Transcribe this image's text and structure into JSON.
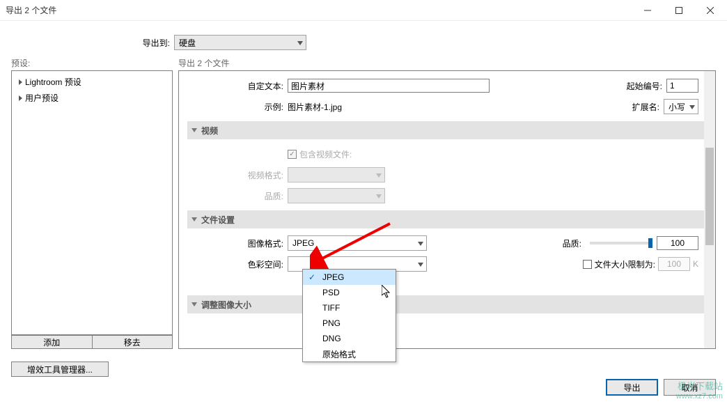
{
  "window": {
    "title": "导出 2 个文件"
  },
  "export_to": {
    "label": "导出到:",
    "value": "硬盘"
  },
  "presets": {
    "heading": "预设:",
    "items": [
      {
        "label": "Lightroom 预设"
      },
      {
        "label": "用户预设"
      }
    ],
    "add": "添加",
    "remove": "移去",
    "plugin_mgr": "增效工具管理器..."
  },
  "form": {
    "heading": "导出 2 个文件",
    "custom_text_label": "自定文本:",
    "custom_text_value": "图片素材",
    "start_num_label": "起始编号:",
    "start_num_value": "1",
    "example_label": "示例:",
    "example_value": "图片素材-1.jpg",
    "ext_label": "扩展名:",
    "ext_value": "小写",
    "section_video": "视频",
    "include_video": "包含视频文件:",
    "video_fmt_label": "视频格式:",
    "quality_label_a": "品质:",
    "section_file": "文件设置",
    "image_fmt_label": "图像格式:",
    "image_fmt_value": "JPEG",
    "quality_label_b": "品质:",
    "quality_value": "100",
    "color_space_label": "色彩空间:",
    "size_limit_label": "文件大小限制为:",
    "size_limit_value": "100",
    "size_limit_unit": "K",
    "section_resize": "调整图像大小"
  },
  "dropdown": {
    "items": [
      "JPEG",
      "PSD",
      "TIFF",
      "PNG",
      "DNG",
      "原始格式"
    ],
    "selected_index": 0
  },
  "buttons": {
    "export": "导出",
    "cancel": "取消"
  },
  "watermark": {
    "line1": "极光下载站",
    "line2": "www.xz7.com"
  }
}
